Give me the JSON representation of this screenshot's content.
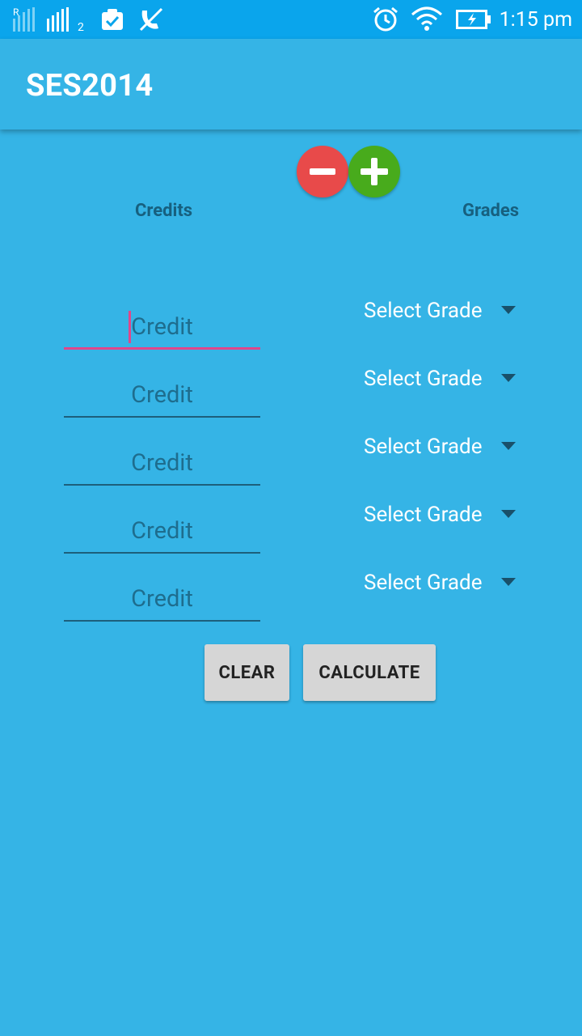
{
  "status_bar": {
    "sim1_label": "R",
    "sim2_label": "2",
    "time": "1:15 pm"
  },
  "app_bar": {
    "title": "SES2014"
  },
  "headers": {
    "credits": "Credits",
    "grades": "Grades"
  },
  "credit_fields": [
    {
      "placeholder": "Credit",
      "value": ""
    },
    {
      "placeholder": "Credit",
      "value": ""
    },
    {
      "placeholder": "Credit",
      "value": ""
    },
    {
      "placeholder": "Credit",
      "value": ""
    },
    {
      "placeholder": "Credit",
      "value": ""
    }
  ],
  "grade_selects": [
    {
      "label": "Select Grade"
    },
    {
      "label": "Select Grade"
    },
    {
      "label": "Select Grade"
    },
    {
      "label": "Select Grade"
    },
    {
      "label": "Select Grade"
    }
  ],
  "buttons": {
    "clear": "CLEAR",
    "calculate": "CALCULATE"
  },
  "colors": {
    "background": "#35b4e6",
    "status_bar": "#0aa5ec",
    "minus": "#e84a4a",
    "plus": "#48ab1c",
    "focus_accent": "#e0468a"
  },
  "icons": [
    "signal-icon",
    "clipboard-check-icon",
    "phone-icon",
    "alarm-icon",
    "wifi-icon",
    "battery-icon",
    "minus-icon",
    "plus-icon",
    "dropdown-caret-icon"
  ]
}
